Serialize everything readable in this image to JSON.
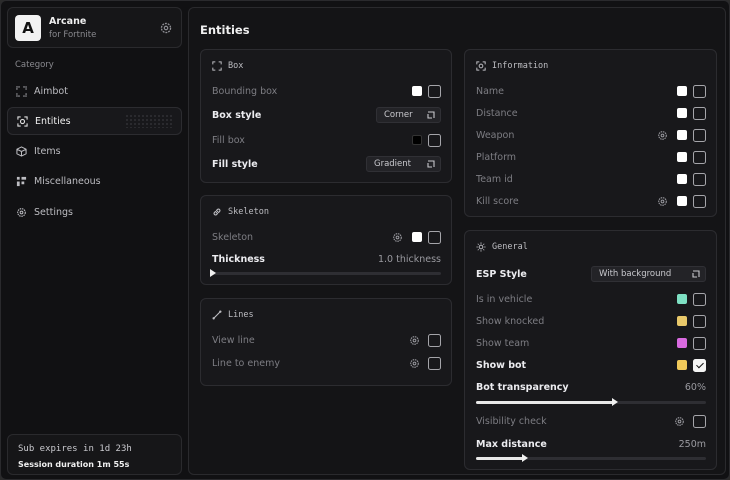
{
  "brand": {
    "logo": "A",
    "name": "Arcane",
    "subtitle": "for Fortnite",
    "settings_icon": "gear-icon"
  },
  "sidebar": {
    "category_label": "Category",
    "items": [
      {
        "label": "Aimbot",
        "icon": "crosshair-frame-icon",
        "active": false
      },
      {
        "label": "Entities",
        "icon": "target-icon",
        "active": true
      },
      {
        "label": "Items",
        "icon": "cube-icon",
        "active": false
      },
      {
        "label": "Miscellaneous",
        "icon": "grid-icon",
        "active": false
      },
      {
        "label": "Settings",
        "icon": "gear-icon",
        "active": false
      }
    ]
  },
  "subscription": {
    "expires": "Sub expires in 1d 23h",
    "session_label": "Session duration",
    "session_value": "1m 55s"
  },
  "main": {
    "title": "Entities"
  },
  "box": {
    "title": "Box",
    "bounding_box": "Bounding box",
    "box_style_label": "Box style",
    "box_style_value": "Corner",
    "fill_box": "Fill box",
    "fill_style_label": "Fill style",
    "fill_style_value": "Gradient"
  },
  "skeleton": {
    "title": "Skeleton",
    "skeleton_label": "Skeleton",
    "thickness_label": "Thickness",
    "thickness_value": "1.0 thickness",
    "thickness_fraction": 0.0
  },
  "lines": {
    "title": "Lines",
    "view_line": "View line",
    "line_to_enemy": "Line to enemy"
  },
  "information": {
    "title": "Information",
    "name": "Name",
    "distance": "Distance",
    "weapon": "Weapon",
    "platform": "Platform",
    "team_id": "Team id",
    "kill_score": "Kill score"
  },
  "general": {
    "title": "General",
    "esp_style_label": "ESP Style",
    "esp_style_value": "With background",
    "is_in_vehicle": "Is in vehicle",
    "show_knocked": "Show knocked",
    "show_team": "Show team",
    "show_bot": "Show bot",
    "bot_transparency_label": "Bot transparency",
    "bot_transparency_value": "60%",
    "bot_transparency_fraction": 0.6,
    "visibility_check": "Visibility check",
    "max_distance_label": "Max distance",
    "max_distance_value": "250m",
    "max_distance_fraction": 0.21
  },
  "colors": {
    "vehicle": "#7ee0c3",
    "knocked": "#e8c86a",
    "team": "#d96ae0",
    "bot": "#f0c95a",
    "white": "#ffffff",
    "black": "#000000"
  }
}
